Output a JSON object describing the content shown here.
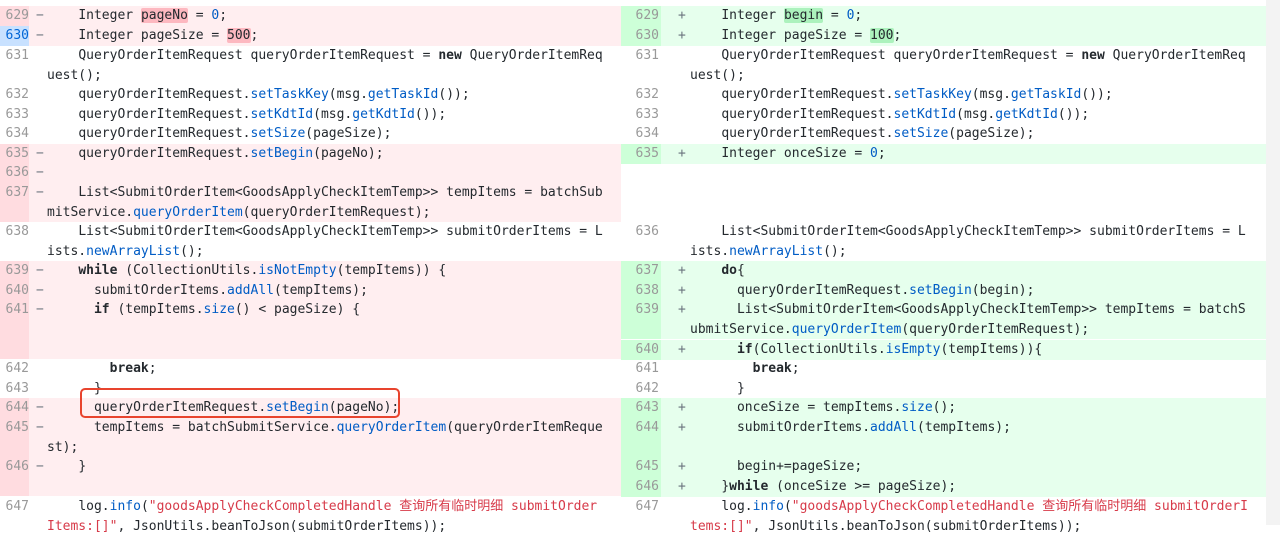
{
  "left": {
    "rows": [
      {
        "num": "629",
        "type": "del",
        "code": [
          {
            "t": "    Integer "
          },
          {
            "t": "pageNo",
            "c": "delw"
          },
          {
            "t": " = "
          },
          {
            "t": "0",
            "c": "m"
          },
          {
            "t": ";"
          }
        ]
      },
      {
        "num": "630",
        "type": "delhl",
        "code": [
          {
            "t": "    Integer pageSize = "
          },
          {
            "t": "500",
            "c": "delw"
          },
          {
            "t": ";"
          }
        ]
      },
      {
        "num": "631",
        "type": "ctx",
        "code": [
          {
            "t": "    QueryOrderItemRequest queryOrderItemRequest = "
          },
          {
            "t": "new",
            "c": "kw"
          },
          {
            "t": " QueryOrderItemRequest();"
          }
        ]
      },
      {
        "num": "632",
        "type": "ctx",
        "code": [
          {
            "t": "    queryOrderItemRequest."
          },
          {
            "t": "setTaskKey",
            "c": "m"
          },
          {
            "t": "(msg."
          },
          {
            "t": "getTaskId",
            "c": "m"
          },
          {
            "t": "());"
          }
        ]
      },
      {
        "num": "633",
        "type": "ctx",
        "code": [
          {
            "t": "    queryOrderItemRequest."
          },
          {
            "t": "setKdtId",
            "c": "m"
          },
          {
            "t": "(msg."
          },
          {
            "t": "getKdtId",
            "c": "m"
          },
          {
            "t": "());"
          }
        ]
      },
      {
        "num": "634",
        "type": "ctx",
        "code": [
          {
            "t": "    queryOrderItemRequest."
          },
          {
            "t": "setSize",
            "c": "m"
          },
          {
            "t": "(pageSize);"
          }
        ]
      },
      {
        "num": "635",
        "type": "del",
        "code": [
          {
            "t": "    queryOrderItemRequest."
          },
          {
            "t": "setBegin",
            "c": "m"
          },
          {
            "t": "(pageNo);"
          }
        ]
      },
      {
        "num": "636",
        "type": "del",
        "code": [
          {
            "t": ""
          }
        ]
      },
      {
        "num": "637",
        "type": "del",
        "code": [
          {
            "t": "    List<SubmitOrderItem<GoodsApplyCheckItemTemp>> tempItems = batchSubmitService."
          },
          {
            "t": "queryOrderItem",
            "c": "m"
          },
          {
            "t": "(queryOrderItemRequest);"
          }
        ]
      },
      {
        "num": "638",
        "type": "ctx",
        "code": [
          {
            "t": "    List<SubmitOrderItem<GoodsApplyCheckItemTemp>> submitOrderItems = Lists."
          },
          {
            "t": "newArrayList",
            "c": "m"
          },
          {
            "t": "();"
          }
        ]
      },
      {
        "num": "639",
        "type": "del",
        "code": [
          {
            "t": "    "
          },
          {
            "t": "while",
            "c": "kw"
          },
          {
            "t": " (CollectionUtils."
          },
          {
            "t": "isNotEmpty",
            "c": "m"
          },
          {
            "t": "(tempItems)) {"
          }
        ]
      },
      {
        "num": "640",
        "type": "del",
        "code": [
          {
            "t": "      submitOrderItems."
          },
          {
            "t": "addAll",
            "c": "m"
          },
          {
            "t": "(tempItems);"
          }
        ]
      },
      {
        "num": "641",
        "type": "del",
        "code": [
          {
            "t": "      "
          },
          {
            "t": "if",
            "c": "kw"
          },
          {
            "t": " (tempItems."
          },
          {
            "t": "size",
            "c": "m"
          },
          {
            "t": "() < pageSize) {"
          }
        ]
      },
      {
        "num": "642",
        "type": "ctx",
        "code": [
          {
            "t": "        "
          },
          {
            "t": "break",
            "c": "kw"
          },
          {
            "t": ";"
          }
        ]
      },
      {
        "num": "643",
        "type": "ctx",
        "code": [
          {
            "t": "      }"
          }
        ]
      },
      {
        "num": "644",
        "type": "del",
        "code": [
          {
            "t": "      queryOrderItemRequest."
          },
          {
            "t": "setBegin",
            "c": "m"
          },
          {
            "t": "(pageNo);"
          }
        ]
      },
      {
        "num": "645",
        "type": "del",
        "code": [
          {
            "t": "      tempItems = batchSubmitService."
          },
          {
            "t": "queryOrderItem",
            "c": "m"
          },
          {
            "t": "(queryOrderItemRequest);"
          }
        ]
      },
      {
        "num": "646",
        "type": "del",
        "code": [
          {
            "t": "    }"
          }
        ]
      },
      {
        "num": "647",
        "type": "ctx",
        "code": [
          {
            "t": "    log."
          },
          {
            "t": "info",
            "c": "m"
          },
          {
            "t": "("
          },
          {
            "t": "\"goodsApplyCheckCompletedHandle 查询所有临时明细 submitOrderItems:[]\"",
            "c": "s"
          },
          {
            "t": ", JsonUtils.beanToJson(submitOrderItems));"
          }
        ]
      }
    ]
  },
  "right": {
    "rows": [
      {
        "num": "629",
        "type": "add",
        "code": [
          {
            "t": "    Integer "
          },
          {
            "t": "begin",
            "c": "addw"
          },
          {
            "t": " = "
          },
          {
            "t": "0",
            "c": "m"
          },
          {
            "t": ";"
          }
        ]
      },
      {
        "num": "630",
        "type": "add",
        "code": [
          {
            "t": "    Integer pageSize = "
          },
          {
            "t": "100",
            "c": "addw"
          },
          {
            "t": ";"
          }
        ]
      },
      {
        "num": "631",
        "type": "ctx",
        "code": [
          {
            "t": "    QueryOrderItemRequest queryOrderItemRequest = "
          },
          {
            "t": "new",
            "c": "kw"
          },
          {
            "t": " QueryOrderItemRequest();"
          }
        ]
      },
      {
        "num": "632",
        "type": "ctx",
        "code": [
          {
            "t": "    queryOrderItemRequest."
          },
          {
            "t": "setTaskKey",
            "c": "m"
          },
          {
            "t": "(msg."
          },
          {
            "t": "getTaskId",
            "c": "m"
          },
          {
            "t": "());"
          }
        ]
      },
      {
        "num": "633",
        "type": "ctx",
        "code": [
          {
            "t": "    queryOrderItemRequest."
          },
          {
            "t": "setKdtId",
            "c": "m"
          },
          {
            "t": "(msg."
          },
          {
            "t": "getKdtId",
            "c": "m"
          },
          {
            "t": "());"
          }
        ]
      },
      {
        "num": "634",
        "type": "ctx",
        "code": [
          {
            "t": "    queryOrderItemRequest."
          },
          {
            "t": "setSize",
            "c": "m"
          },
          {
            "t": "(pageSize);"
          }
        ]
      },
      {
        "num": "635",
        "type": "add",
        "code": [
          {
            "t": "    Integer onceSize = "
          },
          {
            "t": "0",
            "c": "m"
          },
          {
            "t": ";"
          }
        ]
      },
      {
        "num": "636",
        "type": "ctx",
        "code": [
          {
            "t": "    List<SubmitOrderItem<GoodsApplyCheckItemTemp>> submitOrderItems = Lists."
          },
          {
            "t": "newArrayList",
            "c": "m"
          },
          {
            "t": "();"
          }
        ]
      },
      {
        "num": "637",
        "type": "add",
        "code": [
          {
            "t": "    "
          },
          {
            "t": "do",
            "c": "kw"
          },
          {
            "t": "{"
          }
        ]
      },
      {
        "num": "638",
        "type": "add",
        "code": [
          {
            "t": "      queryOrderItemRequest."
          },
          {
            "t": "setBegin",
            "c": "m"
          },
          {
            "t": "(begin);"
          }
        ]
      },
      {
        "num": "639",
        "type": "add",
        "code": [
          {
            "t": "      List<SubmitOrderItem<GoodsApplyCheckItemTemp>> tempItems = batchSubmitService."
          },
          {
            "t": "queryOrderItem",
            "c": "m"
          },
          {
            "t": "(queryOrderItemRequest);"
          }
        ]
      },
      {
        "num": "640",
        "type": "add",
        "code": [
          {
            "t": "      "
          },
          {
            "t": "if",
            "c": "kw"
          },
          {
            "t": "(CollectionUtils."
          },
          {
            "t": "isEmpty",
            "c": "m"
          },
          {
            "t": "(tempItems)){"
          }
        ]
      },
      {
        "num": "641",
        "type": "ctx",
        "code": [
          {
            "t": "        "
          },
          {
            "t": "break",
            "c": "kw"
          },
          {
            "t": ";"
          }
        ]
      },
      {
        "num": "642",
        "type": "ctx",
        "code": [
          {
            "t": "      }"
          }
        ]
      },
      {
        "num": "643",
        "type": "add",
        "code": [
          {
            "t": "      onceSize = tempItems."
          },
          {
            "t": "size",
            "c": "m"
          },
          {
            "t": "();"
          }
        ]
      },
      {
        "num": "644",
        "type": "add",
        "code": [
          {
            "t": "      submitOrderItems."
          },
          {
            "t": "addAll",
            "c": "m"
          },
          {
            "t": "(tempItems);"
          }
        ]
      },
      {
        "num": "645",
        "type": "add",
        "code": [
          {
            "t": "      begin+=pageSize;"
          }
        ]
      },
      {
        "num": "646",
        "type": "add",
        "code": [
          {
            "t": "    }"
          },
          {
            "t": "while",
            "c": "kw"
          },
          {
            "t": " (onceSize >= pageSize);"
          }
        ]
      },
      {
        "num": "647",
        "type": "ctx",
        "code": [
          {
            "t": "    log."
          },
          {
            "t": "info",
            "c": "m"
          },
          {
            "t": "("
          },
          {
            "t": "\"goodsApplyCheckCompletedHandle 查询所有临时明细 submitOrderItems:[]\"",
            "c": "s"
          },
          {
            "t": ", JsonUtils.beanToJson(submitOrderItems));"
          }
        ]
      }
    ]
  },
  "signs": {
    "del": "−",
    "add": "+"
  }
}
